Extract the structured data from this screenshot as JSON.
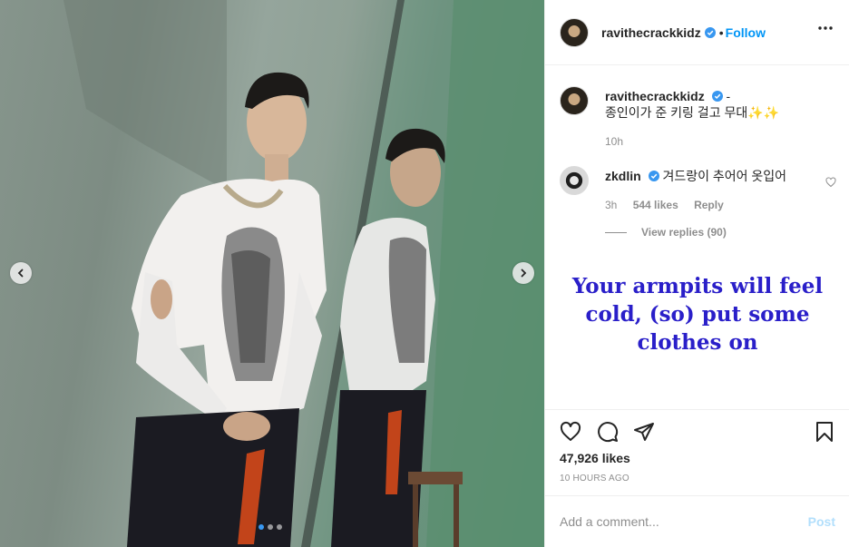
{
  "post": {
    "username": "ravithecrackkidz",
    "follow_label": "Follow",
    "dot_separator": "•"
  },
  "caption": {
    "username": "ravithecrackkidz",
    "suffix": "-",
    "text": "종인이가 준 키링 걸고 무대✨✨",
    "time": "10h"
  },
  "comment": {
    "username": "zkdlin",
    "text": "겨드랑이 추어어 옷입어",
    "time": "3h",
    "likes": "544 likes",
    "reply_label": "Reply",
    "view_replies": "View replies (90)"
  },
  "annotation": {
    "line1": "Your armpits will feel",
    "line2": "cold, (so) put some",
    "line3": "clothes on"
  },
  "stats": {
    "likes": "47,926 likes",
    "posted": "10 HOURS AGO"
  },
  "comment_box": {
    "placeholder": "Add a comment...",
    "post_label": "Post"
  },
  "carousel": {
    "count": 3,
    "active_index": 0
  },
  "colors": {
    "accent": "#0095f6",
    "verified": "#3897f0",
    "annotation": "#2a1fc9",
    "post_disabled": "#b2dffc"
  },
  "icons": [
    "chevron-left-icon",
    "chevron-right-icon",
    "more-icon",
    "verified-icon",
    "heart-icon",
    "comment-icon",
    "share-icon",
    "bookmark-icon"
  ]
}
